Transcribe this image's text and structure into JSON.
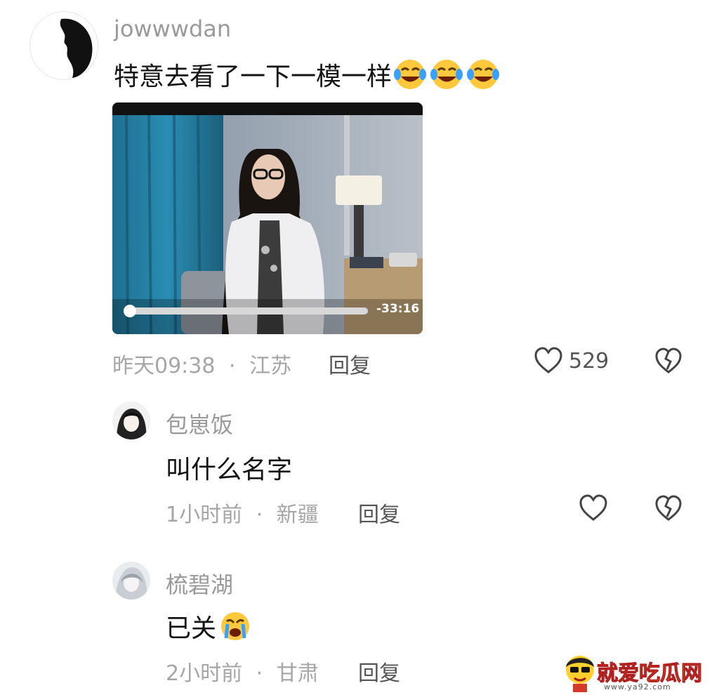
{
  "comment": {
    "username": "jowwwdan",
    "text": "特意去看了一下一模一样",
    "emoji": "rofl-emoji",
    "video": {
      "duration": "-33:16",
      "progress": 0.0
    },
    "time": "昨天09:38",
    "separator": "·",
    "location": "江苏",
    "reply_label": "回复",
    "like_count": "529",
    "icons": {
      "like": "heart-icon",
      "dislike": "broken-heart-icon"
    }
  },
  "replies": [
    {
      "username": "包崽饭",
      "text": "叫什么名字",
      "time": "1小时前",
      "separator": "·",
      "location": "新疆",
      "reply_label": "回复"
    },
    {
      "username": "梳碧湖",
      "text": "已关",
      "emoji": "crying-emoji",
      "time": "2小时前",
      "separator": "·",
      "location": "甘肃",
      "reply_label": "回复"
    }
  ],
  "watermark": {
    "text": "就爱吃瓜网",
    "url": "www.ya92.com"
  }
}
